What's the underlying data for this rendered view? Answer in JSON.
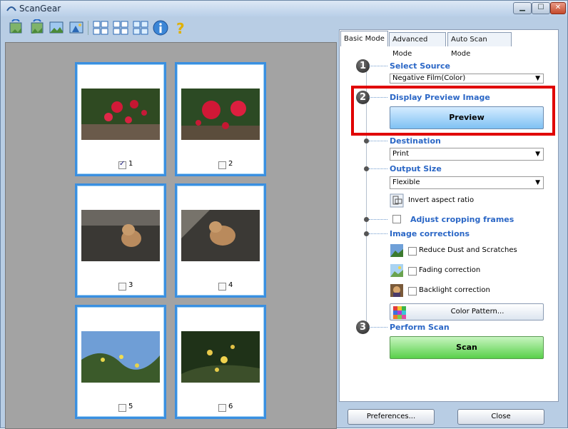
{
  "window": {
    "title": "ScanGear"
  },
  "toolbar": {
    "buttons": [
      "rotate-left-icon",
      "rotate-right-icon",
      "auto-crop-icon",
      "invert-icon",
      "view-large-icon",
      "view-medium-icon",
      "view-small-icon",
      "info-icon",
      "help-icon"
    ]
  },
  "thumbnails": [
    {
      "label": "1",
      "checked": true,
      "selected": true
    },
    {
      "label": "2",
      "checked": false,
      "selected": true
    },
    {
      "label": "3",
      "checked": false,
      "selected": true
    },
    {
      "label": "4",
      "checked": false,
      "selected": true
    },
    {
      "label": "5",
      "checked": false,
      "selected": true
    },
    {
      "label": "6",
      "checked": false,
      "selected": true
    }
  ],
  "tabs": [
    "Basic Mode",
    "Advanced Mode",
    "Auto Scan Mode"
  ],
  "panel": {
    "step1": {
      "num": "1",
      "title": "Select Source",
      "value": "Negative Film(Color)"
    },
    "step2": {
      "num": "2",
      "title": "Display Preview Image",
      "button": "Preview"
    },
    "destination": {
      "title": "Destination",
      "value": "Print"
    },
    "output_size": {
      "title": "Output Size",
      "value": "Flexible",
      "invert": "Invert aspect ratio"
    },
    "adjust": {
      "title": "Adjust cropping frames"
    },
    "corrections": {
      "title": "Image corrections",
      "dust": "Reduce Dust and Scratches",
      "fading": "Fading correction",
      "backlight": "Backlight correction",
      "color_pattern": "Color Pattern..."
    },
    "step3": {
      "num": "3",
      "title": "Perform Scan",
      "button": "Scan"
    }
  },
  "footer": {
    "preferences": "Preferences...",
    "close": "Close"
  },
  "colors": {
    "accent": "#2b67c6",
    "highlight": "#e00000",
    "preview_btn": "#7fc1f3",
    "scan_btn": "#59d04a"
  }
}
